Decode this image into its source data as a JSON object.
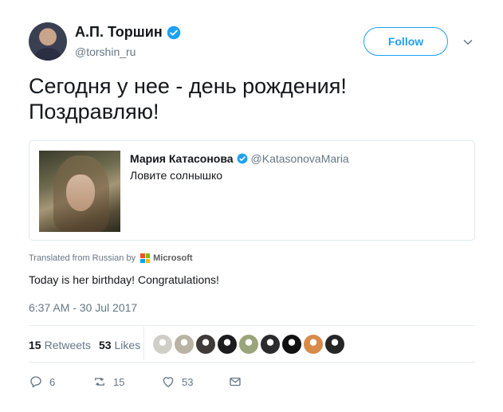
{
  "author": {
    "display_name": "А.П. Торшин",
    "handle": "@torshin_ru",
    "verified": true
  },
  "follow_label": "Follow",
  "tweet_text_line1": "Сегодня у нее - день рождения!",
  "tweet_text_line2": "Поздравляю!",
  "quoted": {
    "display_name": "Мария Катасонова",
    "handle": "@KatasonovaMaria",
    "text": "Ловите солнышко"
  },
  "translation": {
    "label": "Translated from Russian by",
    "provider": "Microsoft",
    "text": "Today is her birthday! Congratulations!"
  },
  "timestamp": "6:37 AM - 30 Jul 2017",
  "stats": {
    "retweets_count": "15",
    "retweets_label": "Retweets",
    "likes_count": "53",
    "likes_label": "Likes"
  },
  "likers": [
    {
      "name": "liker-1",
      "color": "#cfcfc8"
    },
    {
      "name": "liker-2",
      "color": "#b9b3a3"
    },
    {
      "name": "liker-3",
      "color": "#3f3a37"
    },
    {
      "name": "liker-4",
      "color": "#1d1d1f"
    },
    {
      "name": "liker-5",
      "color": "#9aa47a"
    },
    {
      "name": "liker-6",
      "color": "#2b2b2e"
    },
    {
      "name": "liker-7",
      "color": "#111111"
    },
    {
      "name": "liker-8",
      "color": "#d78a4a"
    },
    {
      "name": "liker-9",
      "color": "#262626"
    }
  ],
  "actions": {
    "reply_count": "6",
    "retweet_count": "15",
    "like_count": "53"
  },
  "colors": {
    "accent": "#1da1f2",
    "secondary_text": "#657786"
  }
}
